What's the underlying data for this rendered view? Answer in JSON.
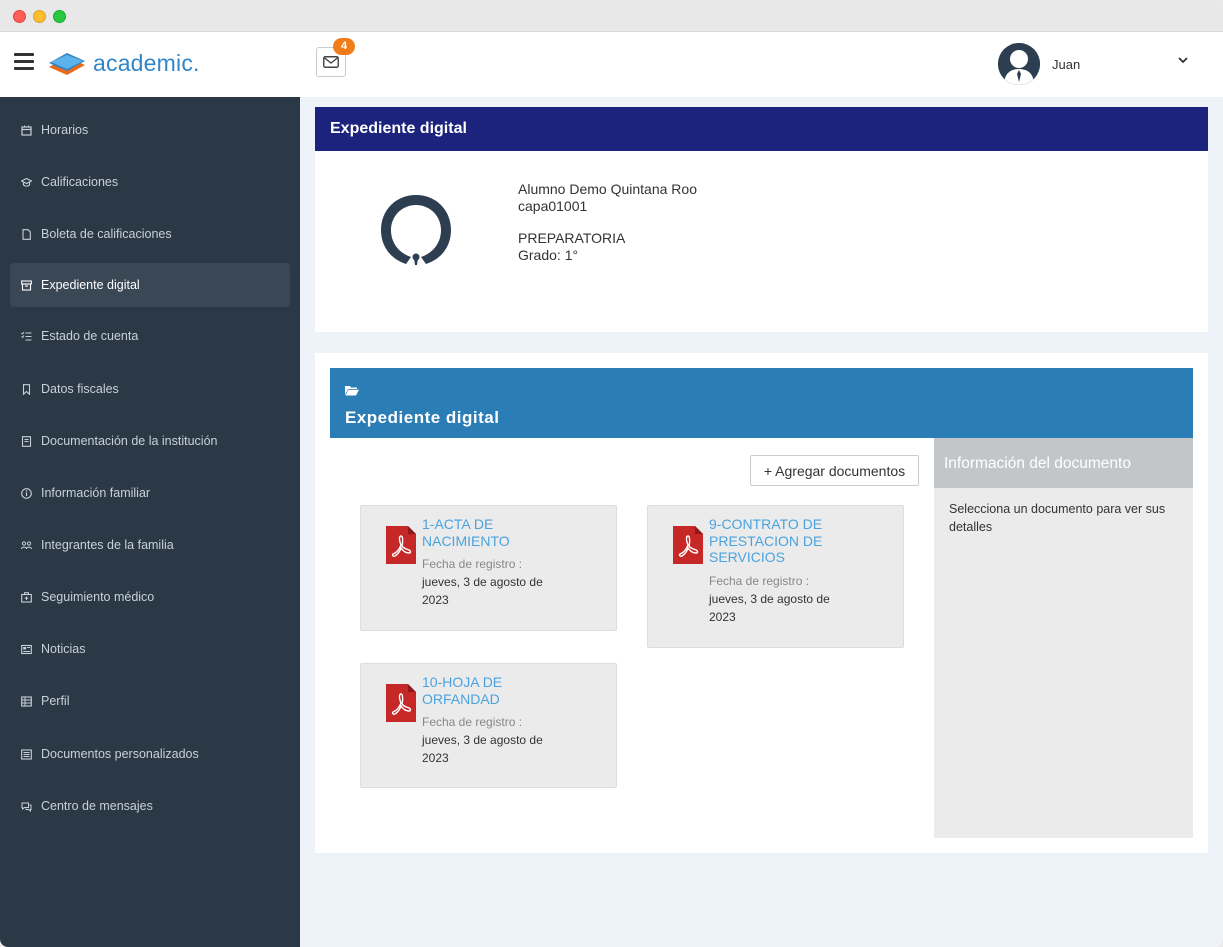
{
  "app": {
    "logo_text": "academic.",
    "mail_count": "4",
    "user_name": "Juan"
  },
  "sidebar": {
    "items": [
      {
        "label": "Horarios",
        "icon": "calendar-icon"
      },
      {
        "label": "Calificaciones",
        "icon": "graduation-cap-icon"
      },
      {
        "label": "Boleta de calificaciones",
        "icon": "file-icon"
      },
      {
        "label": "Expediente digital",
        "icon": "archive-icon",
        "active": true
      },
      {
        "label": "Estado de cuenta",
        "icon": "list-check-icon"
      },
      {
        "label": "Datos fiscales",
        "icon": "bookmark-icon"
      },
      {
        "label": "Documentación de la institución",
        "icon": "book-icon"
      },
      {
        "label": "Información familiar",
        "icon": "info-circle-icon"
      },
      {
        "label": "Integrantes de la familia",
        "icon": "users-icon"
      },
      {
        "label": "Seguimiento médico",
        "icon": "medkit-icon"
      },
      {
        "label": "Noticias",
        "icon": "newspaper-icon"
      },
      {
        "label": "Perfil",
        "icon": "table-icon"
      },
      {
        "label": "Documentos personalizados",
        "icon": "list-alt-icon"
      },
      {
        "label": "Centro de mensajes",
        "icon": "comments-icon"
      }
    ]
  },
  "profile": {
    "card_title": "Expediente digital",
    "name": "Alumno Demo Quintana Roo",
    "id": "capa01001",
    "level": "PREPARATORIA",
    "grade": "Grado: 1°"
  },
  "expediente": {
    "title": "Expediente digital",
    "add_button": "+ Agregar documentos",
    "documents": [
      {
        "title": "1-ACTA DE NACIMIENTO",
        "date_label": "Fecha de registro :",
        "date": "jueves, 3 de agosto de 2023"
      },
      {
        "title": "9-CONTRATO DE PRESTACION DE SERVICIOS",
        "date_label": "Fecha de registro :",
        "date": "jueves, 3 de agosto de 2023"
      },
      {
        "title": "10-HOJA DE ORFANDAD",
        "date_label": "Fecha de registro :",
        "date": "jueves, 3 de agosto de 2023"
      }
    ],
    "info_panel": {
      "title": "Información del documento",
      "body": "Selecciona un documento para ver sus detalles"
    }
  },
  "colors": {
    "sidebar_bg": "#2b3946",
    "profile_header": "#1b237d",
    "expediente_header": "#2a7db5",
    "link": "#4aa3df",
    "badge": "#f07d1a",
    "pdf_red": "#c62828"
  }
}
